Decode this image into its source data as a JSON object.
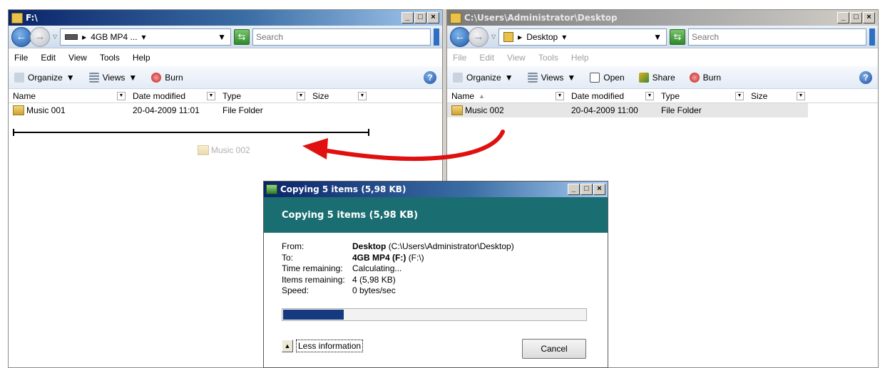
{
  "left_window": {
    "title": "F:\\",
    "address_label": "4GB MP4 ...",
    "search_placeholder": "Search",
    "menu": [
      "File",
      "Edit",
      "View",
      "Tools",
      "Help"
    ],
    "toolbar": {
      "organize": "Organize",
      "views": "Views",
      "burn": "Burn"
    },
    "columns": [
      "Name",
      "Date modified",
      "Type",
      "Size"
    ],
    "rows": [
      {
        "name": "Music 001",
        "date": "20-04-2009 11:01",
        "type": "File Folder"
      }
    ],
    "drag_ghost": "Music 002"
  },
  "right_window": {
    "title": "C:\\Users\\Administrator\\Desktop",
    "address_label": "Desktop",
    "search_placeholder": "Search",
    "menu": [
      "File",
      "Edit",
      "View",
      "Tools",
      "Help"
    ],
    "toolbar": {
      "organize": "Organize",
      "views": "Views",
      "open": "Open",
      "share": "Share",
      "burn": "Burn"
    },
    "columns": [
      "Name",
      "Date modified",
      "Type",
      "Size"
    ],
    "rows": [
      {
        "name": "Music 002",
        "date": "20-04-2009 11:00",
        "type": "File Folder"
      }
    ]
  },
  "copy_dialog": {
    "title": "Copying 5 items (5,98 KB)",
    "banner": "Copying 5 items (5,98 KB)",
    "from_label": "From:",
    "from_bold": "Desktop",
    "from_path": "(C:\\Users\\Administrator\\Desktop)",
    "to_label": "To:",
    "to_bold": "4GB MP4 (F:)",
    "to_path": "(F:\\)",
    "time_label": "Time remaining:",
    "time_value": "Calculating...",
    "items_label": "Items remaining:",
    "items_value": "4 (5,98 KB)",
    "speed_label": "Speed:",
    "speed_value": "0 bytes/sec",
    "progress_fraction": 0.2,
    "less_info": "Less information",
    "cancel": "Cancel"
  },
  "colors": {
    "arrow": "#e01010",
    "progress": "#163a80",
    "banner": "#1a6e72"
  }
}
